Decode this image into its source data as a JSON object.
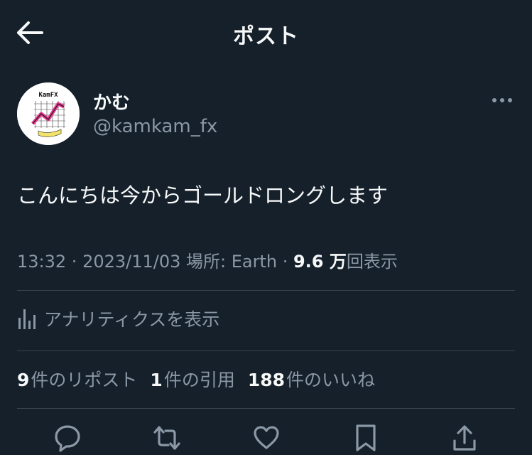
{
  "header": {
    "title": "ポスト",
    "back_icon": "arrow-left-icon"
  },
  "author": {
    "name": "かむ",
    "handle": "@kamkam_fx",
    "avatar_text": "KamFX"
  },
  "tweet": {
    "text": "こんにちは今からゴールドロングします"
  },
  "meta": {
    "time": "13:32",
    "sep1": " · ",
    "date": "2023/11/03",
    "location_label": " 場所: ",
    "location": "Earth",
    "sep2": " · ",
    "views_num": "9.6 万",
    "views_label": "回表示"
  },
  "analytics": {
    "label": "アナリティクスを表示",
    "icon": "bar-chart-icon"
  },
  "stats": {
    "reposts_num": "9",
    "reposts_label": "件のリポスト",
    "quotes_num": "1",
    "quotes_label": "件の引用",
    "likes_num": "188",
    "likes_label": "件のいいね"
  },
  "actions": [
    "reply-icon",
    "retweet-icon",
    "heart-icon",
    "bookmark-icon",
    "share-icon"
  ],
  "colors": {
    "background": "#15202b",
    "text": "#f7f9f9",
    "secondary": "#8b98a5",
    "divider": "#38444d",
    "avatar_accent": "#e0388a"
  }
}
